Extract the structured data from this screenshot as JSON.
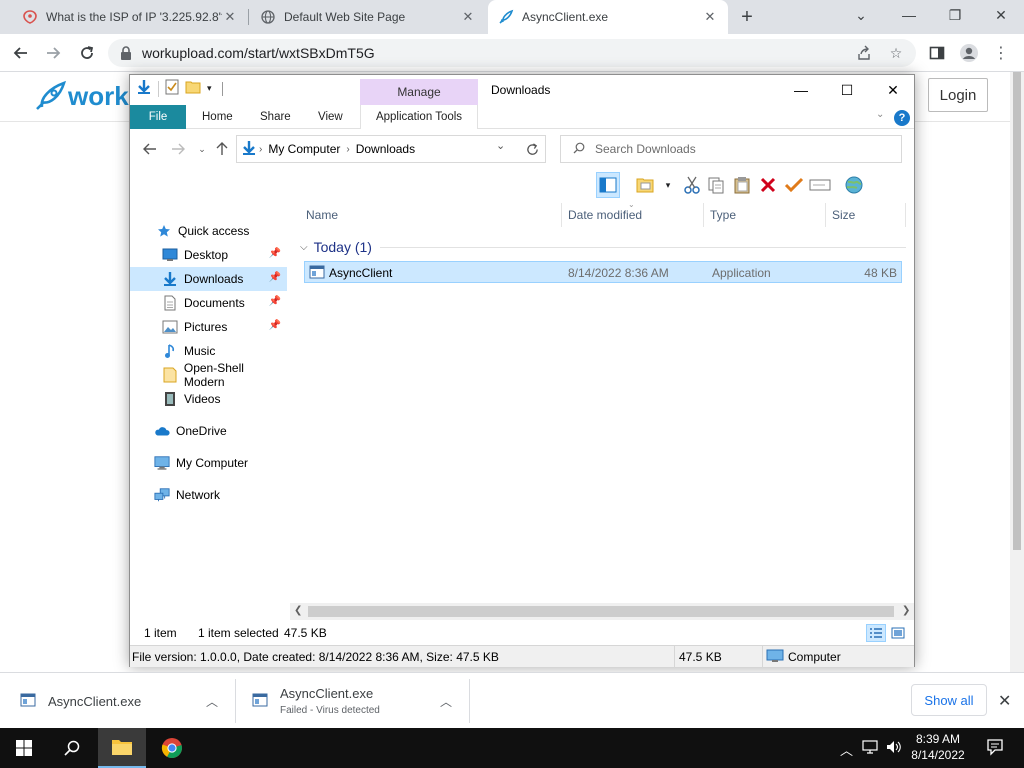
{
  "browser": {
    "tabs": [
      {
        "title": "What is the ISP of IP '3.225.92.8'?",
        "icon": "ipinfo-favicon"
      },
      {
        "title": "Default Web Site Page",
        "icon": "globe-icon"
      },
      {
        "title": "AsyncClient.exe",
        "icon": "workupload-favicon",
        "active": true
      }
    ],
    "url": "workupload.com/start/wxtSBxDmT5G"
  },
  "webpage": {
    "logo_text": "worku",
    "login_label": "Login",
    "brand_color": "#1f8ccf"
  },
  "explorer": {
    "title": "Downloads",
    "manage_label": "Manage",
    "ribbon_tabs": [
      "File",
      "Home",
      "Share",
      "View"
    ],
    "app_tools_label": "Application Tools",
    "address": {
      "root": "My Computer",
      "current": "Downloads"
    },
    "search_placeholder": "Search Downloads",
    "nav": {
      "quick_access": "Quick access",
      "items": [
        "Desktop",
        "Downloads",
        "Documents",
        "Pictures",
        "Music",
        "Open-Shell Modern",
        "Videos"
      ],
      "onedrive": "OneDrive",
      "my_computer": "My Computer",
      "network": "Network"
    },
    "columns": [
      "Name",
      "Date modified",
      "Type",
      "Size"
    ],
    "group": "Today (1)",
    "file": {
      "name": "AsyncClient",
      "date": "8/14/2022 8:36 AM",
      "type": "Application",
      "size": "48 KB"
    },
    "status": {
      "count": "1 item",
      "selected": "1 item selected",
      "size": "47.5 KB"
    },
    "details": {
      "info": "File version: 1.0.0.0, Date created: 8/14/2022 8:36 AM, Size: 47.5 KB",
      "size": "47.5 KB",
      "location": "Computer"
    }
  },
  "downloads": {
    "items": [
      {
        "name": "AsyncClient.exe",
        "status": ""
      },
      {
        "name": "AsyncClient.exe",
        "status": "Failed - Virus detected"
      }
    ],
    "show_all": "Show all"
  },
  "taskbar": {
    "time": "8:39 AM",
    "date": "8/14/2022"
  }
}
